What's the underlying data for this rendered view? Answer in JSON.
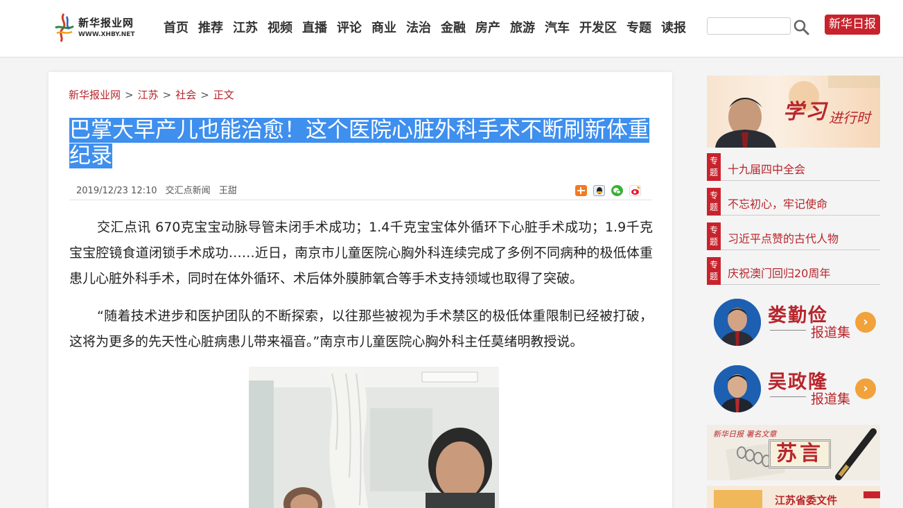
{
  "header": {
    "logo_cn": "新华报业网",
    "logo_en": "WWW.XHBY.NET",
    "nav": [
      "首页",
      "推荐",
      "江苏",
      "视频",
      "直播",
      "评论",
      "商业",
      "法治",
      "金融",
      "房产",
      "旅游",
      "汽车",
      "开发区",
      "专题",
      "读报"
    ],
    "search_placeholder": "",
    "xhrb_label": "新华日报"
  },
  "breadcrumb": {
    "items": [
      "新华报业网",
      "江苏",
      "社会",
      "正文"
    ],
    "sep": ">"
  },
  "article": {
    "title": "巴掌大早产儿也能治愈！这个医院心脏外科手术不断刷新体重纪录",
    "date": "2019/12/23 12:10",
    "source": "交汇点新闻",
    "author": "王甜",
    "paragraphs": [
      "交汇点讯 670克宝宝动脉导管未闭手术成功；1.4千克宝宝体外循环下心脏手术成功；1.9千克宝宝腔镜食道闭锁手术成功……近日，南京市儿童医院心胸外科连续完成了多例不同病种的极低体重患儿心脏外科手术，同时在体外循环、术后体外膜肺氧合等手术支持领域也取得了突破。",
      "“随着技术进步和医护团队的不断探索，以往那些被视为手术禁区的极低体重限制已经被打破，这将为更多的先天性心脏病患儿带来福音。”南京市儿童医院心胸外科主任莫绪明教授说。"
    ],
    "share_icons": [
      "share-plus-icon",
      "qq-icon",
      "wechat-icon",
      "weibo-icon"
    ]
  },
  "sidebar": {
    "study_banner_text": "学习进行时",
    "topic_tag": "专题",
    "topics": [
      "十九届四中全会",
      "不忘初心，牢记使命",
      "习近平点赞的古代人物",
      "庆祝澳门回归20周年"
    ],
    "people": [
      {
        "name": "娄勤俭",
        "sub": "报道集"
      },
      {
        "name": "吴政隆",
        "sub": "报道集"
      }
    ],
    "suyan_top": "新华日报 署名文章",
    "suyan_label": "苏言",
    "wenjian_label": "江苏省委文件"
  },
  "colors": {
    "brand_red": "#c8232c",
    "link_red": "#b8252b",
    "highlight_blue": "#3e8fee",
    "arrow_orange": "#f2a23b"
  }
}
